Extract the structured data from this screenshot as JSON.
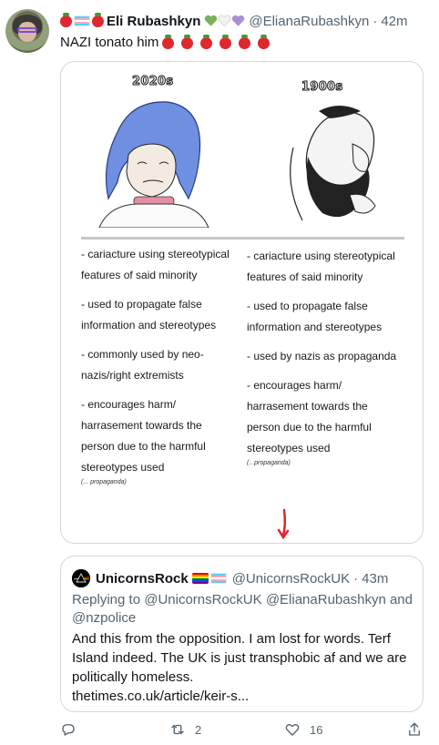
{
  "tweet": {
    "display_name": "Eli Rubashkyn",
    "handle": "@ElianaRubashkyn",
    "time": "42m",
    "text": "NAZI tonato him",
    "name_emoji_left": [
      "tomato-emoji",
      "trans-flag-emoji",
      "tomato-emoji"
    ],
    "name_emoji_right": [
      "green-heart-emoji",
      "white-heart-emoji",
      "purple-heart-emoji"
    ],
    "text_emoji": [
      "tomato-emoji",
      "tomato-emoji",
      "tomato-emoji",
      "tomato-emoji",
      "tomato-emoji",
      "tomato-emoji"
    ]
  },
  "media": {
    "left_title": "2020s",
    "right_title": "1900s",
    "left_items": [
      "- cariacture using stereotypical features of said minority",
      "- used to propagate false information and stereotypes",
      "- commonly used by neo-nazis/right extremists",
      "- encourages harm/ harrasement towards the person due to the harmful stereotypes used"
    ],
    "left_footnote": "(... propaganda)",
    "right_items": [
      "- cariacture using stereotypical features of said minority",
      "- used to propagate false information and stereotypes",
      "- used by nazis as propaganda",
      "- encourages harm/ harrasement towards the person due to the harmful stereotypes used"
    ],
    "right_footnote": "(...propaganda)",
    "accent_arrow_color": "#e0242a"
  },
  "quote": {
    "display_name": "UnicornsRock",
    "handle": "@UnicornsRockUK",
    "time": "43m",
    "name_emoji": [
      "rainbow-flag-emoji",
      "trans-flag-emoji"
    ],
    "reply_prefix": "Replying to",
    "reply_to": "@UnicornsRockUK @ElianaRubashkyn and @nzpolice",
    "body": "And this from the opposition. I am lost for words. Terf Island indeed. The UK is just transphobic af and we are politically homeless.",
    "link": "thetimes.co.uk/article/keir-s..."
  },
  "actions": {
    "reply_count": "",
    "retweet_count": "2",
    "like_count": "16",
    "icons": [
      "reply-icon",
      "retweet-icon",
      "like-icon",
      "share-icon"
    ]
  },
  "colors": {
    "text_primary": "#0f1419",
    "text_secondary": "#536471",
    "border": "#cfd9de"
  }
}
